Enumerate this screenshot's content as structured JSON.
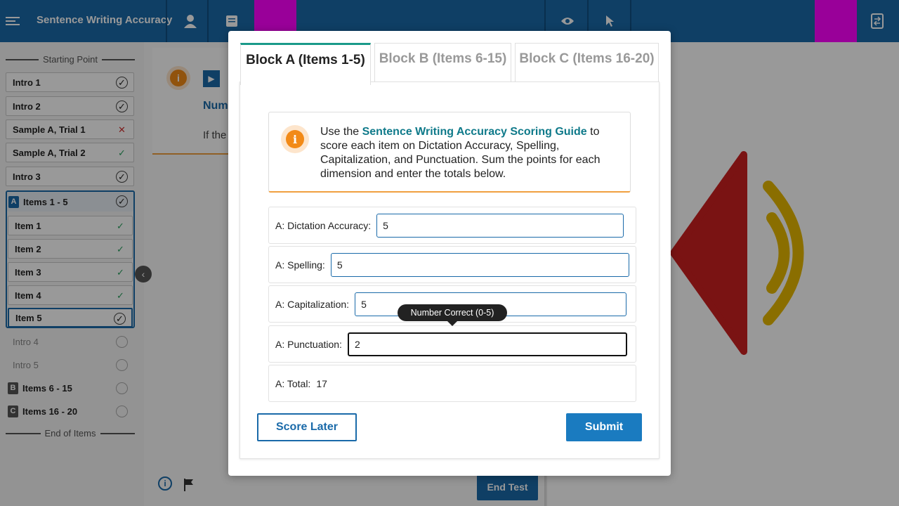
{
  "app": {
    "title": "Sentence Writing Accuracy"
  },
  "sidebar": {
    "start_label": "Starting Point",
    "end_label": "End of Items",
    "items": [
      {
        "label": "Intro 1",
        "status": "complete"
      },
      {
        "label": "Intro 2",
        "status": "complete"
      },
      {
        "label": "Sample A, Trial 1",
        "status": "incorrect"
      },
      {
        "label": "Sample A, Trial 2",
        "status": "correct"
      },
      {
        "label": "Intro 3",
        "status": "complete"
      }
    ],
    "group_a": {
      "badge": "A",
      "label": "Items 1 - 5",
      "items": [
        {
          "label": "Item 1",
          "status": "correct"
        },
        {
          "label": "Item 2",
          "status": "correct"
        },
        {
          "label": "Item 3",
          "status": "correct"
        },
        {
          "label": "Item 4",
          "status": "correct"
        },
        {
          "label": "Item 5",
          "status": "complete"
        }
      ]
    },
    "intro4": "Intro 4",
    "intro5": "Intro 5",
    "group_b": {
      "badge": "B",
      "label": "Items 6 - 15"
    },
    "group_c": {
      "badge": "C",
      "label": "Items 16 - 20"
    }
  },
  "main": {
    "heading_fragment": "Num",
    "text_fragment": "If the",
    "end_test": "End Test"
  },
  "modal": {
    "tabs": [
      {
        "label": "Block A (Items 1-5)"
      },
      {
        "label": "Block B (Items 6-15)"
      },
      {
        "label": "Block C (Items 16-20)"
      }
    ],
    "info": {
      "prefix": "Use the ",
      "link": "Sentence Writing Accuracy Scoring Guide",
      "suffix": " to score each item on Dictation Accuracy, Spelling, Capitalization, and Punctuation. Sum the points for each dimension and enter the totals below."
    },
    "fields": {
      "dictation": {
        "label": "A: Dictation Accuracy:",
        "value": "5"
      },
      "spelling": {
        "label": "A: Spelling:",
        "value": "5"
      },
      "capitalization": {
        "label": "A: Capitalization:",
        "value": "5"
      },
      "punctuation": {
        "label": "A: Punctuation:",
        "value": "2"
      }
    },
    "total": {
      "label": "A: Total:",
      "value": "17"
    },
    "tooltip": "Number Correct (0-5)",
    "score_later": "Score Later",
    "submit": "Submit"
  },
  "colors": {
    "primary": "#1a6aa9",
    "accent_teal": "#1a9a8a",
    "info_orange": "#f28a17",
    "magenta_marker": "#ff00ff"
  }
}
